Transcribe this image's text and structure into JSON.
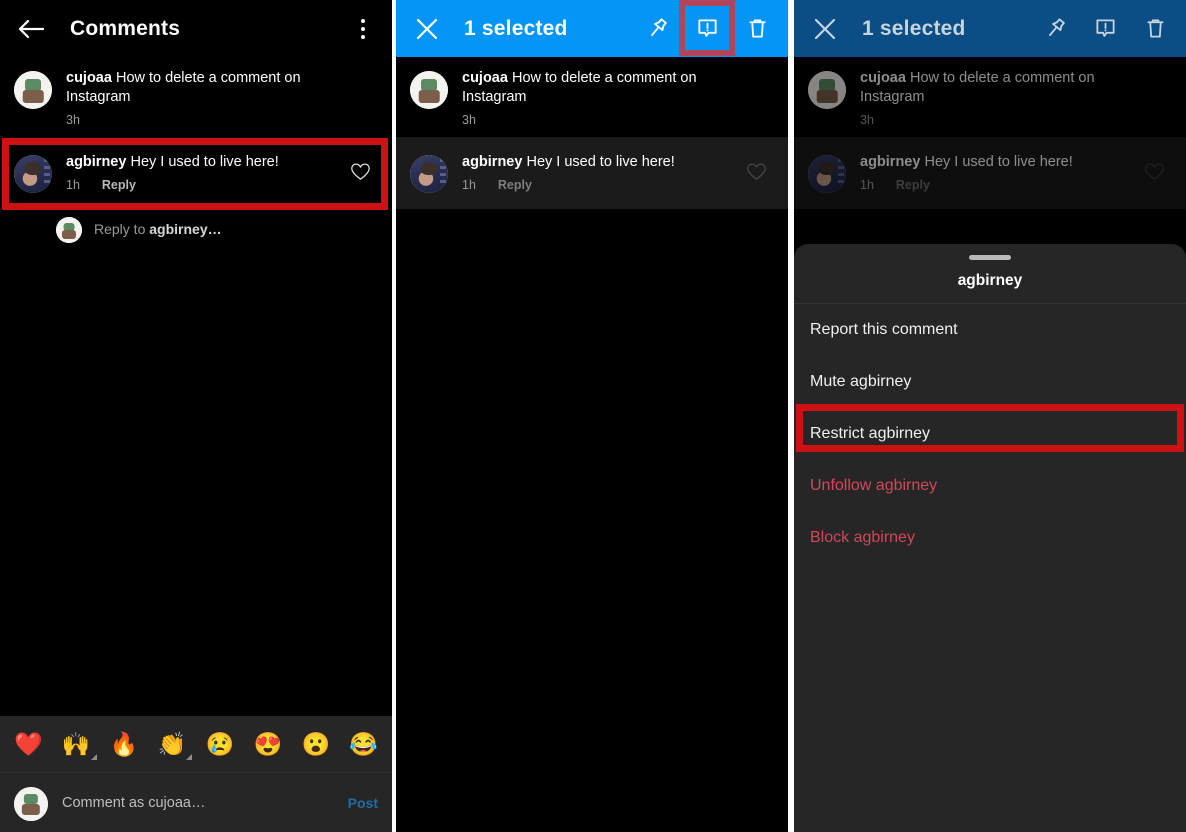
{
  "colors": {
    "accent_blue": "#0495f6",
    "accent_blue_dim": "#0a4e85",
    "highlight_red": "#cc1212",
    "highlight_red_muted": "#b0455c",
    "danger_text": "#d2475a",
    "panel_bg": "#000000",
    "sheet_bg": "#262626",
    "post_link": "#1d6ea8"
  },
  "panel1": {
    "header": {
      "back_icon": "back-arrow-icon",
      "title": "Comments",
      "overflow_icon": "kebab-menu-icon"
    },
    "comments": [
      {
        "username": "cujoaa",
        "text": "How to delete a comment on Instagram",
        "time": "3h",
        "reply_label": "",
        "avatar": "bot-avatar",
        "has_like": false
      },
      {
        "username": "agbirney",
        "text": "Hey I used to live here!",
        "time": "1h",
        "reply_label": "Reply",
        "avatar": "guy-avatar",
        "has_like": true
      }
    ],
    "reply_prompt": {
      "prefix": "Reply to ",
      "target": "agbirney…",
      "avatar": "bot-avatar"
    },
    "emoji_bar": [
      "❤️",
      "🙌",
      "🔥",
      "👏",
      "😢",
      "😍",
      "😮",
      "😂"
    ],
    "composer": {
      "placeholder": "Comment as cujoaa…",
      "post_label": "Post",
      "avatar": "bot-avatar"
    }
  },
  "panel2": {
    "header": {
      "close_icon": "close-x-icon",
      "title": "1 selected",
      "actions": [
        {
          "icon": "pin-icon",
          "highlighted": false
        },
        {
          "icon": "report-exclamation-icon",
          "highlighted": true
        },
        {
          "icon": "trash-delete-icon",
          "highlighted": false
        }
      ]
    },
    "comments": [
      {
        "username": "cujoaa",
        "text": "How to delete a comment on Instagram",
        "time": "3h",
        "reply_label": "",
        "avatar": "bot-avatar",
        "has_like": false,
        "selected": false
      },
      {
        "username": "agbirney",
        "text": "Hey I used to live here!",
        "time": "1h",
        "reply_label": "Reply",
        "avatar": "guy-avatar",
        "has_like": true,
        "selected": true
      }
    ]
  },
  "panel3": {
    "header": {
      "close_icon": "close-x-icon",
      "title": "1 selected",
      "actions": [
        {
          "icon": "pin-icon"
        },
        {
          "icon": "report-exclamation-icon"
        },
        {
          "icon": "trash-delete-icon"
        }
      ]
    },
    "comments": [
      {
        "username": "cujoaa",
        "text": "How to delete a comment on Instagram",
        "time": "3h",
        "reply_label": "",
        "avatar": "bot-avatar"
      },
      {
        "username": "agbirney",
        "text": "Hey I used to live here!",
        "time": "1h",
        "reply_label": "Reply",
        "avatar": "guy-avatar"
      }
    ],
    "sheet": {
      "title": "agbirney",
      "items": [
        {
          "label": "Report this comment",
          "danger": false,
          "highlighted": false
        },
        {
          "label": "Mute agbirney",
          "danger": false,
          "highlighted": false
        },
        {
          "label": "Restrict agbirney",
          "danger": false,
          "highlighted": true
        },
        {
          "label": "Unfollow agbirney",
          "danger": true,
          "highlighted": false
        },
        {
          "label": "Block agbirney",
          "danger": true,
          "highlighted": false
        }
      ]
    }
  }
}
